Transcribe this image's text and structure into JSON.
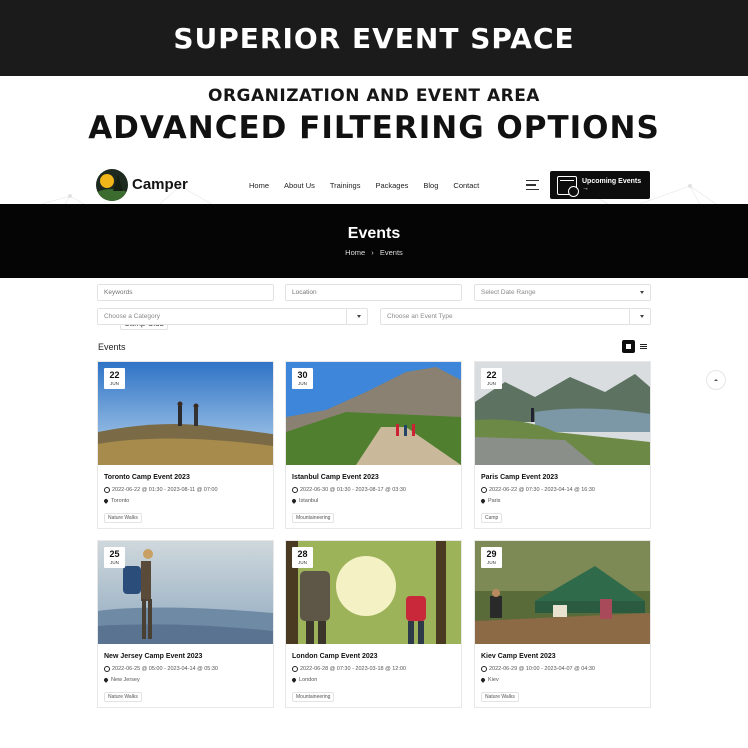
{
  "banner": {
    "title": "SUPERIOR EVENT SPACE"
  },
  "promo": {
    "subtitle": "ORGANIZATION AND EVENT AREA",
    "headline": "ADVANCED FILTERING OPTIONS"
  },
  "header": {
    "logo_name": "Camper",
    "logo_tagline": "Camp Club",
    "nav": [
      "Home",
      "About Us",
      "Trainings",
      "Packages",
      "Blog",
      "Contact"
    ],
    "cta_label": "Upcoming Events →"
  },
  "hero": {
    "title": "Events",
    "breadcrumb_home": "Home",
    "breadcrumb_sep": "›",
    "breadcrumb_current": "Events"
  },
  "filters": {
    "keywords_placeholder": "Keywords",
    "location_placeholder": "Location",
    "date_range": "Select Date Range",
    "category": "Choose a Category",
    "event_type": "Choose an Event Type"
  },
  "section": {
    "title": "Events"
  },
  "events": [
    {
      "day": "22",
      "month": "JUN",
      "title": "Toronto Camp Event 2023",
      "when": "2022-06-22 @ 01:30 - 2023-08-11 @ 07:00",
      "where": "Toronto",
      "tag": "Nature Walks"
    },
    {
      "day": "30",
      "month": "JUN",
      "title": "Istanbul Camp Event 2023",
      "when": "2022-06-30 @ 01:30 - 2023-08-17 @ 03:30",
      "where": "Istanbul",
      "tag": "Mountaineering"
    },
    {
      "day": "22",
      "month": "JUN",
      "title": "Paris Camp Event 2023",
      "when": "2022-06-22 @ 07:30 - 2023-04-14 @ 16:30",
      "where": "Paris",
      "tag": "Camp"
    },
    {
      "day": "25",
      "month": "JUN",
      "title": "New Jersey Camp Event 2023",
      "when": "2022-06-25 @ 05:00 - 2023-04-14 @ 05:30",
      "where": "New Jersey",
      "tag": "Nature Walks"
    },
    {
      "day": "28",
      "month": "JUN",
      "title": "London Camp Event 2023",
      "when": "2022-06-28 @ 07:30 - 2023-03-18 @ 12:00",
      "where": "London",
      "tag": "Mountaineering"
    },
    {
      "day": "29",
      "month": "JUN",
      "title": "Kiev Camp Event 2023",
      "when": "2022-06-29 @ 10:00 - 2023-04-07 @ 04:30",
      "where": "Kiev",
      "tag": "Nature Walks"
    }
  ]
}
